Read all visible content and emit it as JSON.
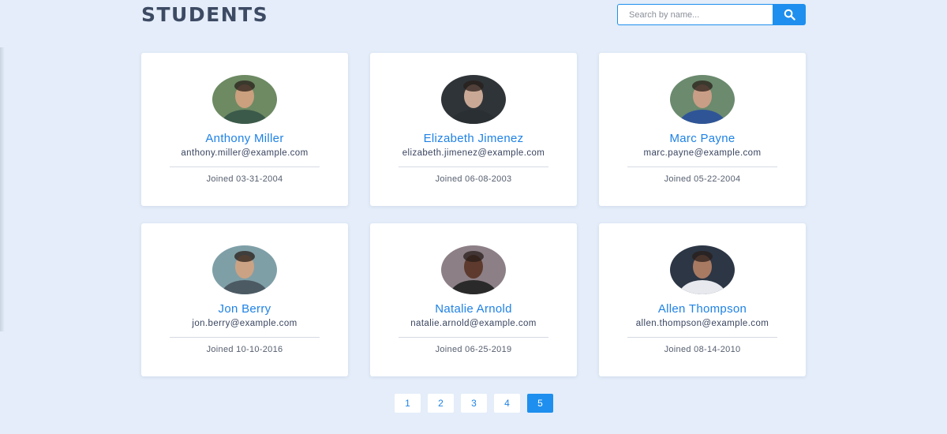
{
  "header": {
    "title": "STUDENTS",
    "search_placeholder": "Search by name...",
    "search_icon": "search-icon"
  },
  "students": [
    {
      "name": "Anthony Miller",
      "email": "anthony.miller@example.com",
      "joined": "Joined 03-31-2004",
      "avatar_bg": "#6d8a63",
      "avatar_fg": "#caa07e",
      "shirt": "#3c5a4a"
    },
    {
      "name": "Elizabeth Jimenez",
      "email": "elizabeth.jimenez@example.com",
      "joined": "Joined 06-08-2003",
      "avatar_bg": "#2f3438",
      "avatar_fg": "#c9a996",
      "shirt": "#2a2f33"
    },
    {
      "name": "Marc Payne",
      "email": "marc.payne@example.com",
      "joined": "Joined 05-22-2004",
      "avatar_bg": "#6b8a6e",
      "avatar_fg": "#c99e86",
      "shirt": "#2f5597"
    },
    {
      "name": "Jon Berry",
      "email": "jon.berry@example.com",
      "joined": "Joined 10-10-2016",
      "avatar_bg": "#7f9fa7",
      "avatar_fg": "#cba384",
      "shirt": "#4c5a63"
    },
    {
      "name": "Natalie Arnold",
      "email": "natalie.arnold@example.com",
      "joined": "Joined 06-25-2019",
      "avatar_bg": "#8c7f86",
      "avatar_fg": "#5d3a2d",
      "shirt": "#2a2a2a"
    },
    {
      "name": "Allen Thompson",
      "email": "allen.thompson@example.com",
      "joined": "Joined 08-14-2010",
      "avatar_bg": "#2c3645",
      "avatar_fg": "#a87a62",
      "shirt": "#e7e9ee"
    }
  ],
  "pagination": {
    "pages": [
      "1",
      "2",
      "3",
      "4",
      "5"
    ],
    "active": "5"
  },
  "colors": {
    "background": "#e4edf9",
    "accent": "#1e8fee",
    "name_text": "#1e82e6",
    "title_text": "#3d4a63"
  }
}
